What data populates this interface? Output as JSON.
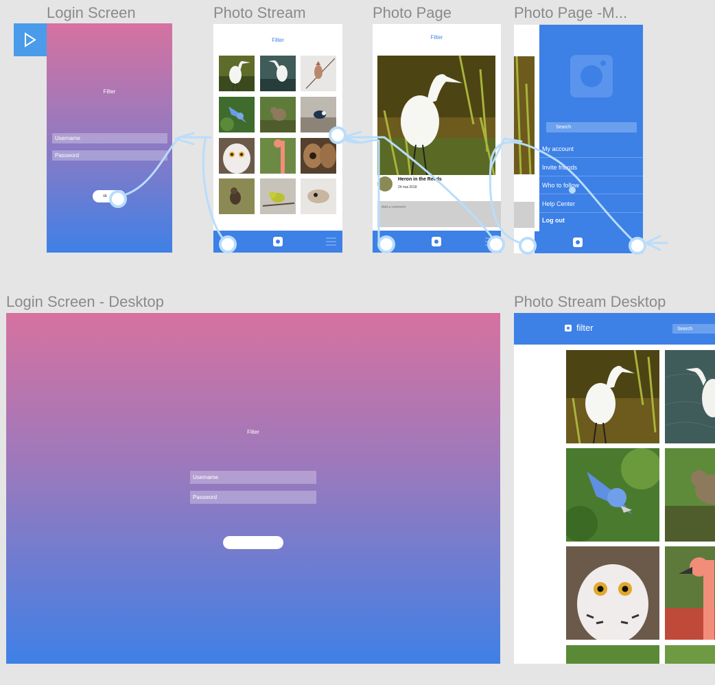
{
  "artboards": {
    "login": "Login Screen",
    "stream": "Photo Stream",
    "photo": "Photo Page",
    "menu": "Photo Page -M...",
    "login_desktop": "Login Screen - Desktop",
    "stream_desktop": "Photo Stream Desktop"
  },
  "login": {
    "logo": "Filter",
    "username_placeholder": "Username",
    "password_placeholder": "Password",
    "button_label": "sk"
  },
  "stream": {
    "header": "Filter"
  },
  "photo": {
    "header": "Filter",
    "caption": "Heron in the Reeds",
    "date": "24 mai 2018",
    "comment_placeholder": "Add a comment"
  },
  "menu": {
    "search_placeholder": "Search",
    "items": [
      "My account",
      "Invite friends",
      "Who to follow",
      "Help Center",
      "Log out"
    ]
  },
  "login_desktop": {
    "logo": "Filter",
    "username_placeholder": "Username",
    "password_placeholder": "Password"
  },
  "stream_desktop": {
    "brand": "filter",
    "search_placeholder": "Search"
  },
  "colors": {
    "canvas": "#e5e5e5",
    "accent_blue": "#3d80e6",
    "gradient_top": "#d672a0",
    "gradient_bottom": "#3f80e6",
    "link": "#4a9bea"
  }
}
